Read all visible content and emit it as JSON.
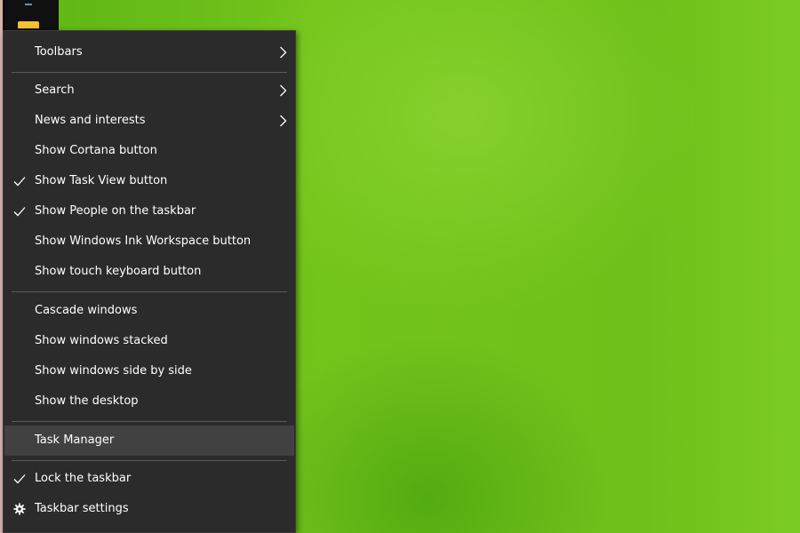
{
  "context_menu": {
    "items": [
      {
        "label": "Toolbars",
        "submenu": true
      },
      {
        "label": "Search",
        "submenu": true
      },
      {
        "label": "News and interests",
        "submenu": true
      },
      {
        "label": "Show Cortana button"
      },
      {
        "label": "Show Task View button",
        "checked": true
      },
      {
        "label": "Show People on the taskbar",
        "checked": true
      },
      {
        "label": "Show Windows Ink Workspace button"
      },
      {
        "label": "Show touch keyboard button"
      },
      {
        "label": "Cascade windows"
      },
      {
        "label": "Show windows stacked"
      },
      {
        "label": "Show windows side by side"
      },
      {
        "label": "Show the desktop"
      },
      {
        "label": "Task Manager",
        "highlighted": true
      },
      {
        "label": "Lock the taskbar",
        "checked": true
      },
      {
        "label": "Taskbar settings",
        "icon": "gear-icon"
      }
    ]
  },
  "colors": {
    "menu_background": "#2b2b2b",
    "menu_highlight": "#414141",
    "menu_text": "#ffffff",
    "desktop_green": "#72c71c",
    "taskbar": "#101010"
  }
}
